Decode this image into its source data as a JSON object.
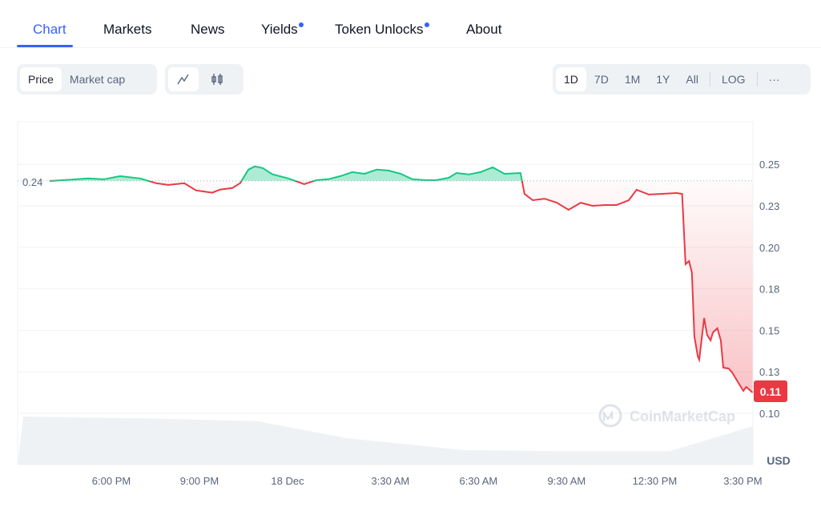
{
  "tabs": [
    {
      "label": "Chart",
      "active": true
    },
    {
      "label": "Markets"
    },
    {
      "label": "News"
    },
    {
      "label": "Yields",
      "dot": true
    },
    {
      "label": "Token Unlocks",
      "dot": true
    },
    {
      "label": "About"
    }
  ],
  "toolbar": {
    "metric": [
      "Price",
      "Market cap"
    ],
    "metric_selected": "Price",
    "chart_style": [
      {
        "icon": "line-chart-icon",
        "selected": true
      },
      {
        "icon": "candlestick-icon"
      }
    ],
    "ranges": [
      "1D",
      "7D",
      "1M",
      "1Y",
      "All"
    ],
    "range_selected": "1D",
    "log_label": "LOG",
    "more_label": "···"
  },
  "colors": {
    "accent": "#3861fb",
    "up": "#16c784",
    "down": "#ea3943"
  },
  "chart_data": {
    "type": "line",
    "baseline": {
      "value": 0.24,
      "label": "0.24"
    },
    "current": {
      "value": 0.1125,
      "label": "0.11"
    },
    "unit": "USD",
    "watermark": "CoinMarketCap",
    "ylim": [
      0.085,
      0.27
    ],
    "y_ticks": [
      {
        "v": 0.25,
        "label": "0.25"
      },
      {
        "v": 0.225,
        "label": "0.23"
      },
      {
        "v": 0.2,
        "label": "0.20"
      },
      {
        "v": 0.175,
        "label": "0.18"
      },
      {
        "v": 0.15,
        "label": "0.15"
      },
      {
        "v": 0.125,
        "label": "0.13"
      },
      {
        "v": 0.1,
        "label": "0.10"
      }
    ],
    "x_ticks": [
      {
        "t": "17 18:00",
        "label": "6:00 PM"
      },
      {
        "t": "17 21:00",
        "label": "9:00 PM"
      },
      {
        "t": "18 00:00",
        "label": "18 Dec"
      },
      {
        "t": "18 03:30",
        "label": "3:30 AM"
      },
      {
        "t": "18 06:30",
        "label": "6:30 AM"
      },
      {
        "t": "18 09:30",
        "label": "9:30 AM"
      },
      {
        "t": "18 12:30",
        "label": "12:30 PM"
      },
      {
        "t": "18 15:30",
        "label": "3:30 PM"
      }
    ],
    "grid": true,
    "points": [
      [
        "17 15:54",
        0.24
      ],
      [
        "17 16:23",
        0.2405
      ],
      [
        "17 17:13",
        0.2415
      ],
      [
        "17 17:45",
        0.241
      ],
      [
        "17 18:18",
        0.2429
      ],
      [
        "17 18:59",
        0.2415
      ],
      [
        "17 19:32",
        0.2386
      ],
      [
        "17 19:56",
        0.2376
      ],
      [
        "17 20:29",
        0.2386
      ],
      [
        "17 20:53",
        0.2343
      ],
      [
        "17 21:26",
        0.2329
      ],
      [
        "17 21:42",
        0.2348
      ],
      [
        "17 22:07",
        0.2357
      ],
      [
        "17 22:23",
        0.2386
      ],
      [
        "17 22:40",
        0.2468
      ],
      [
        "17 22:53",
        0.2488
      ],
      [
        "17 23:09",
        0.2478
      ],
      [
        "17 23:29",
        0.244
      ],
      [
        "18 00:02",
        0.2415
      ],
      [
        "18 00:34",
        0.2381
      ],
      [
        "18 00:59",
        0.2405
      ],
      [
        "18 01:23",
        0.241
      ],
      [
        "18 01:48",
        0.2429
      ],
      [
        "18 02:12",
        0.2453
      ],
      [
        "18 02:37",
        0.2443
      ],
      [
        "18 03:02",
        0.2468
      ],
      [
        "18 03:26",
        0.2463
      ],
      [
        "18 03:51",
        0.2443
      ],
      [
        "18 04:15",
        0.241
      ],
      [
        "18 04:40",
        0.2405
      ],
      [
        "18 05:04",
        0.2405
      ],
      [
        "18 05:29",
        0.2419
      ],
      [
        "18 05:45",
        0.2448
      ],
      [
        "18 06:10",
        0.2439
      ],
      [
        "18 06:34",
        0.2453
      ],
      [
        "18 06:59",
        0.2482
      ],
      [
        "18 07:23",
        0.2443
      ],
      [
        "18 07:56",
        0.2448
      ],
      [
        "18 08:04",
        0.2322
      ],
      [
        "18 08:21",
        0.2284
      ],
      [
        "18 08:45",
        0.2293
      ],
      [
        "18 09:10",
        0.2269
      ],
      [
        "18 09:34",
        0.2226
      ],
      [
        "18 09:59",
        0.2269
      ],
      [
        "18 10:23",
        0.225
      ],
      [
        "18 10:48",
        0.2255
      ],
      [
        "18 11:12",
        0.2255
      ],
      [
        "18 11:37",
        0.2284
      ],
      [
        "18 11:53",
        0.2347
      ],
      [
        "18 12:18",
        0.2318
      ],
      [
        "18 12:42",
        0.2322
      ],
      [
        "18 13:15",
        0.2327
      ],
      [
        "18 13:26",
        0.2322
      ],
      [
        "18 13:33",
        0.1898
      ],
      [
        "18 13:40",
        0.1917
      ],
      [
        "18 13:46",
        0.1849
      ],
      [
        "18 13:51",
        0.1463
      ],
      [
        "18 13:58",
        0.1343
      ],
      [
        "18 14:01",
        0.1323
      ],
      [
        "18 14:11",
        0.1574
      ],
      [
        "18 14:17",
        0.1473
      ],
      [
        "18 14:24",
        0.1439
      ],
      [
        "18 14:29",
        0.1487
      ],
      [
        "18 14:38",
        0.1512
      ],
      [
        "18 14:45",
        0.1439
      ],
      [
        "18 14:50",
        0.1275
      ],
      [
        "18 15:01",
        0.127
      ],
      [
        "18 15:08",
        0.1246
      ],
      [
        "18 15:18",
        0.1198
      ],
      [
        "18 15:31",
        0.1135
      ],
      [
        "18 15:37",
        0.1159
      ],
      [
        "18 15:50",
        0.1125
      ]
    ],
    "volume_relative": [
      [
        "17 15:00",
        1.0
      ],
      [
        "17 20:00",
        0.95
      ],
      [
        "17 23:00",
        0.9
      ],
      [
        "18 02:00",
        0.55
      ],
      [
        "18 06:00",
        0.3
      ],
      [
        "18 09:00",
        0.28
      ],
      [
        "18 13:00",
        0.28
      ],
      [
        "18 14:30",
        0.55
      ],
      [
        "18 15:50",
        0.8
      ]
    ]
  }
}
